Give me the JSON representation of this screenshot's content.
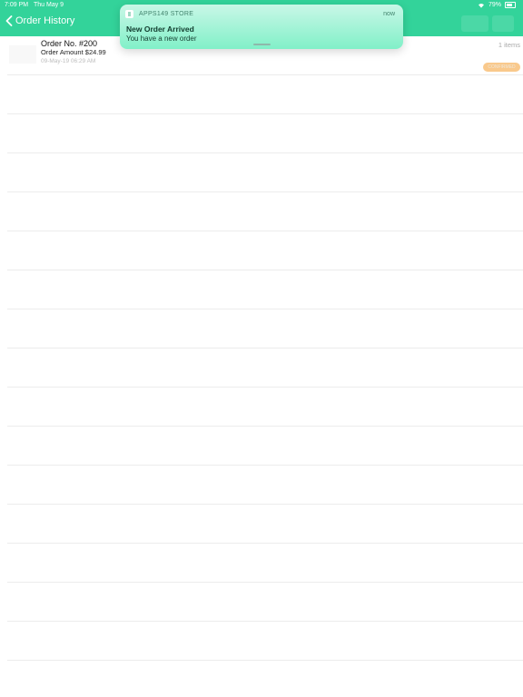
{
  "statusbar": {
    "time": "7:09 PM",
    "date": "Thu May 9",
    "battery": "79%"
  },
  "navbar": {
    "back_label": "Order History"
  },
  "order": {
    "number": "Order No. #200",
    "amount": "Order Amount $24.99",
    "date": "09-May-19 06:29 AM",
    "items": "1 items",
    "status": "CONFIRMED"
  },
  "notification": {
    "app_name": "APPS149 STORE",
    "time": "now",
    "title": "New Order Arrived",
    "body": "You have a new order"
  },
  "colors": {
    "accent": "#33d39a",
    "status_pill": "#f9c98c",
    "divider": "#ececec",
    "notification_bg": "#81f0c8"
  }
}
